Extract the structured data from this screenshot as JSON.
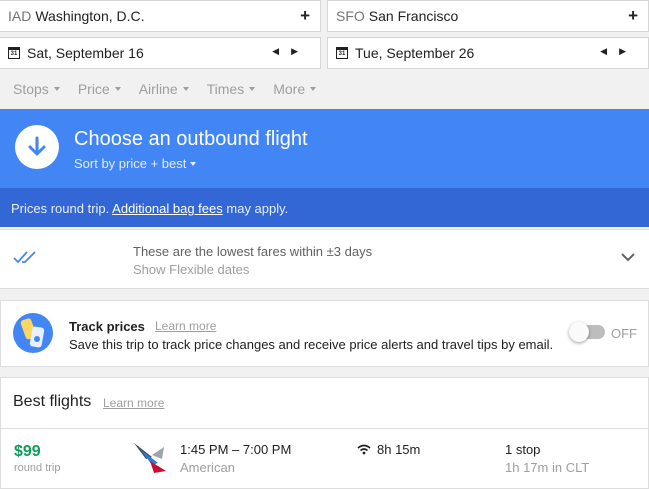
{
  "search": {
    "origin_code": "IAD",
    "origin_city": "Washington, D.C.",
    "destination_code": "SFO",
    "destination_city": "San Francisco",
    "add_icon": "plus-icon",
    "calendar_icon_label": "31",
    "depart_date": "Sat, September 16",
    "return_date": "Tue, September 26"
  },
  "filters": [
    "Stops",
    "Price",
    "Airline",
    "Times",
    "More"
  ],
  "banner": {
    "title": "Choose an outbound flight",
    "sort_label": "Sort by price + best",
    "icon": "arrow-down-icon",
    "color": "#4285f4"
  },
  "prices_notice": {
    "prefix": "Prices round trip.",
    "link": "Additional bag fees",
    "suffix": "may apply."
  },
  "flexible": {
    "line1": "These are the lowest fares within ±3 days",
    "line2": "Show Flexible dates"
  },
  "track": {
    "title": "Track prices",
    "learn_more": "Learn more",
    "description": "Save this trip to track price changes and receive price alerts and travel tips by email.",
    "toggle_label": "OFF"
  },
  "best": {
    "title": "Best flights",
    "learn_more": "Learn more",
    "flights": [
      {
        "price": "$99",
        "price_note": "round trip",
        "times": "1:45 PM – 7:00 PM",
        "airline": "American",
        "duration": "8h 15m",
        "stops": "1 stop",
        "layover": "1h 17m in CLT",
        "price_color": "#0f9d58"
      }
    ]
  }
}
